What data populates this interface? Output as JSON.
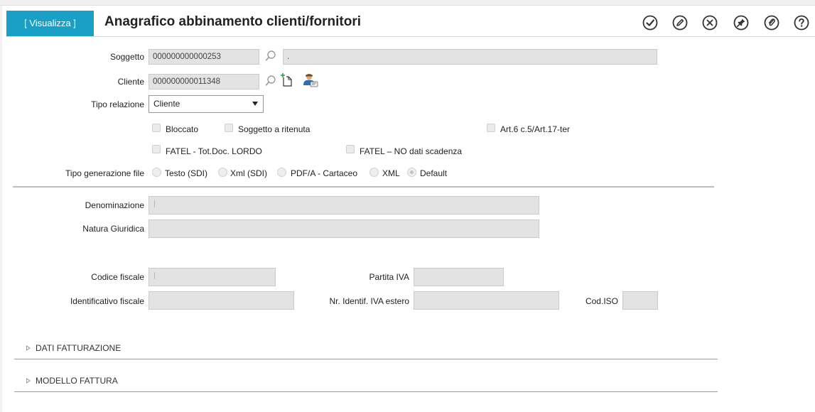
{
  "header": {
    "mode_label": "[ Visualizza ]",
    "title": "Anagrafico abbinamento clienti/fornitori",
    "actions": [
      "confirm-icon",
      "edit-icon",
      "cancel-icon",
      "pin-icon",
      "attachment-icon",
      "help-icon"
    ],
    "accent_color": "#1a9fc6"
  },
  "form": {
    "soggetto": {
      "label": "Soggetto",
      "code": "000000000000253",
      "description": "."
    },
    "cliente": {
      "label": "Cliente",
      "code": "000000000011348"
    },
    "tipo_relazione": {
      "label": "Tipo relazione",
      "value": "Cliente"
    },
    "flags": {
      "bloccato": "Bloccato",
      "soggetto_ritenuta": "Soggetto a ritenuta",
      "art6": "Art.6 c.5/Art.17-ter",
      "fatel_lordo": "FATEL - Tot.Doc. LORDO",
      "fatel_no_scadenza": "FATEL – NO dati scadenza"
    },
    "tipo_generazione": {
      "label": "Tipo generazione file",
      "options": [
        "Testo (SDI)",
        "Xml (SDI)",
        "PDF/A - Cartaceo",
        "XML",
        "Default"
      ],
      "selected": "Default"
    },
    "denominazione": {
      "label": "Denominazione",
      "value": ""
    },
    "natura_giuridica": {
      "label": "Natura Giuridica",
      "value": ""
    },
    "codice_fiscale": {
      "label": "Codice fiscale",
      "value": ""
    },
    "partita_iva": {
      "label": "Partita IVA",
      "value": ""
    },
    "identificativo_fiscale": {
      "label": "Identificativo fiscale",
      "value": ""
    },
    "nr_identif_iva_estero": {
      "label": "Nr. Identif. IVA estero",
      "value": ""
    },
    "cod_iso": {
      "label": "Cod.ISO",
      "value": ""
    }
  },
  "sections": [
    {
      "label": "DATI FATTURAZIONE"
    },
    {
      "label": "MODELLO FATTURA"
    }
  ]
}
